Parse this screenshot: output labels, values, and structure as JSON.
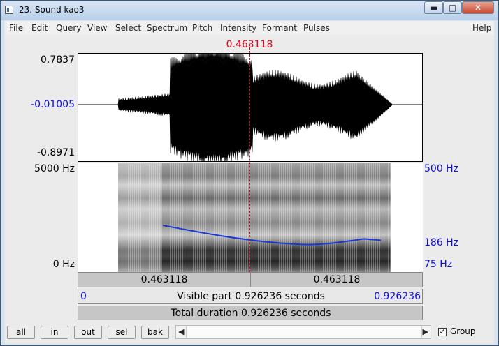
{
  "window": {
    "title": "23. Sound kao3",
    "minimize": "▬",
    "maximize": "□",
    "close": "✕"
  },
  "menu": [
    "File",
    "Edit",
    "Query",
    "View",
    "Select",
    "Spectrum",
    "Pitch",
    "Intensity",
    "Formant",
    "Pulses",
    "Help"
  ],
  "selection_time": "0.463118",
  "waveform": {
    "y_max": "0.7837",
    "y_mid": "-0.01005",
    "y_min": "-0.8971"
  },
  "spectrogram": {
    "freq_top": "5000 Hz",
    "freq_bottom": "0 Hz",
    "pitch_top": "500 Hz",
    "pitch_mid": "186 Hz",
    "pitch_bottom": "75 Hz"
  },
  "time_bar": {
    "left": "0.463118",
    "right": "0.463118"
  },
  "visible_bar": {
    "start": "0",
    "text": "Visible part 0.926236 seconds",
    "end": "0.926236"
  },
  "total_bar": {
    "text": "Total duration 0.926236 seconds"
  },
  "buttons": [
    "all",
    "in",
    "out",
    "sel",
    "bak"
  ],
  "group": {
    "label": "Group",
    "checked": true,
    "check_glyph": "✓"
  },
  "scroll": {
    "left_arrow": "◀",
    "right_arrow": "▶"
  },
  "colors": {
    "cursor": "#e0001a",
    "pitch": "#1a3ad8",
    "axis_blue": "#1010d8"
  }
}
